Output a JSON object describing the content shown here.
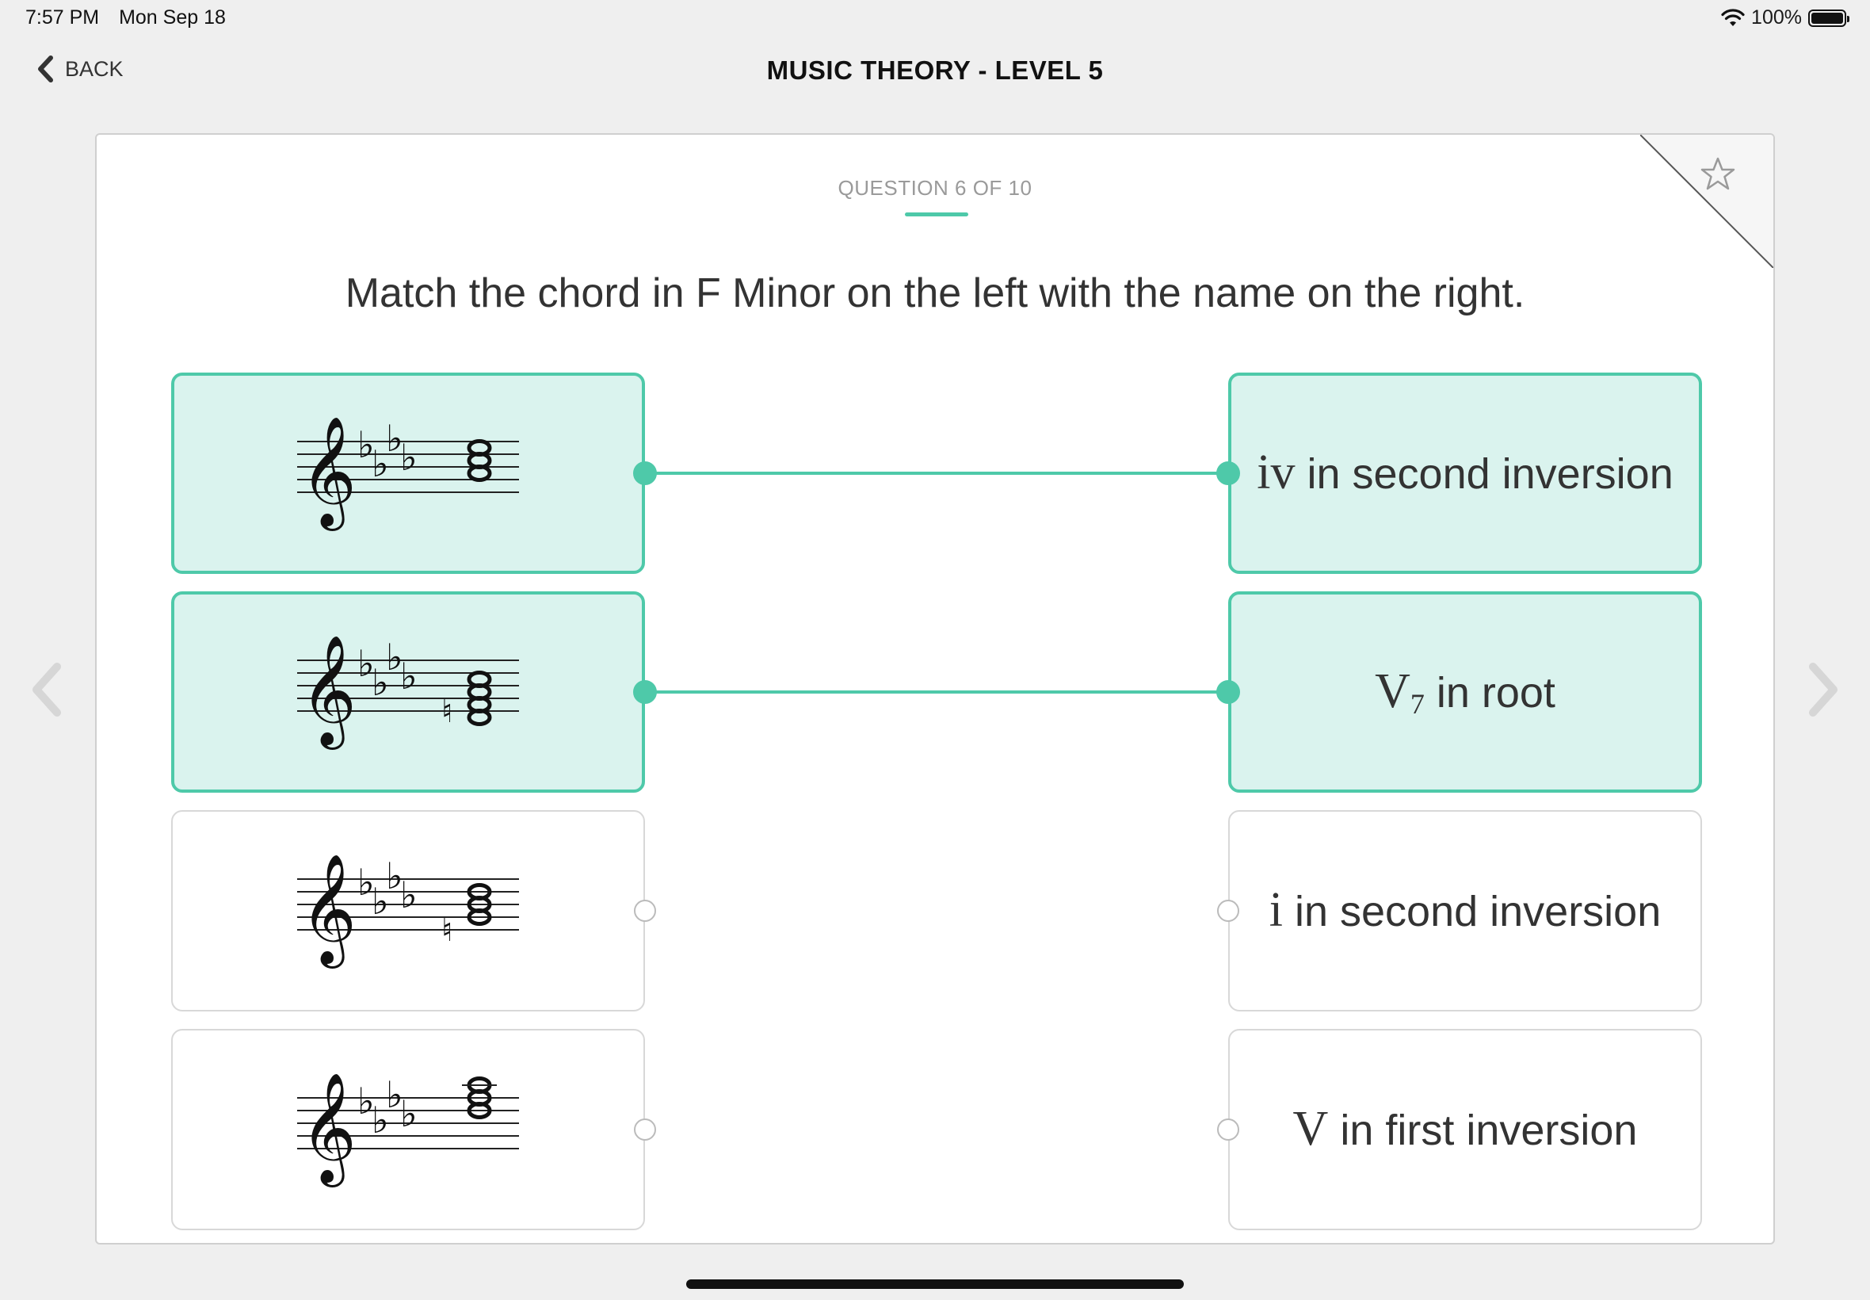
{
  "status": {
    "time": "7:57 PM",
    "date": "Mon Sep 18",
    "battery": "100%",
    "wifi_icon": "wifi-icon",
    "battery_icon": "battery-icon"
  },
  "header": {
    "back_label": "BACK",
    "title": "MUSIC THEORY - LEVEL 5"
  },
  "question": {
    "counter": "QUESTION 6 OF 10",
    "prompt": "Match the chord in F Minor on the left with the name on the right."
  },
  "colors": {
    "accent": "#4ec9a9",
    "matched_bg": "#daf3ee"
  },
  "chords": [
    {
      "id": "chord-1",
      "matched": true
    },
    {
      "id": "chord-2",
      "matched": true
    },
    {
      "id": "chord-3",
      "matched": false
    },
    {
      "id": "chord-4",
      "matched": false
    }
  ],
  "names": [
    {
      "roman": "iv",
      "sub": "",
      "text": " in second inversion",
      "matched": true
    },
    {
      "roman": "V",
      "sub": "7",
      "text": " in root",
      "matched": true
    },
    {
      "roman": "i",
      "sub": "",
      "text": " in second inversion",
      "matched": false
    },
    {
      "roman": "V",
      "sub": "",
      "text": " in first inversion",
      "matched": false
    }
  ]
}
